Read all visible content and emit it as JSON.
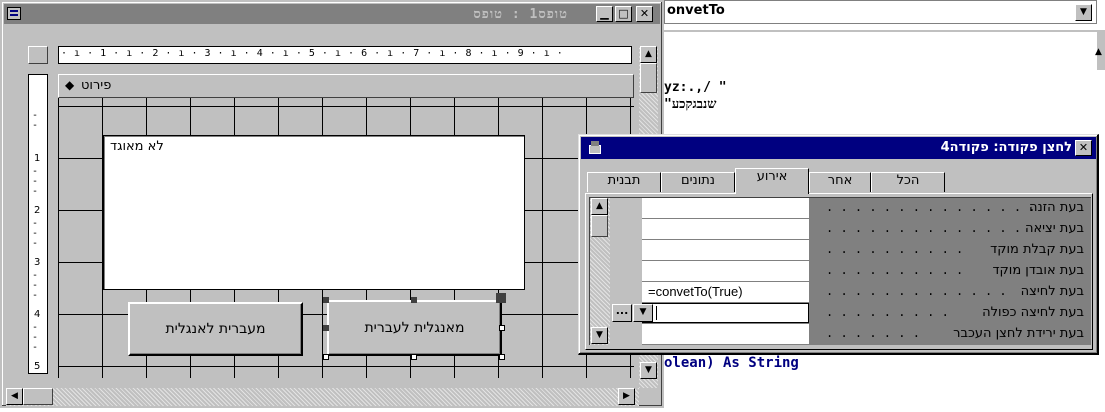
{
  "form_window": {
    "title": "טופס1 : טופס",
    "section_label": "פירוט",
    "ruler_h": [
      "1",
      "2",
      "3",
      "4",
      "5",
      "6",
      "7",
      "8",
      "9"
    ],
    "ruler_v": [
      "1",
      "2",
      "3",
      "4",
      "5"
    ],
    "textbox_text": "לא מאוגד",
    "button_left_label": "מעברית לאנגלית",
    "button_right_label": "מאנגלית לעברית"
  },
  "code_window": {
    "combo_text": "onvetTo",
    "code_lines": [
      "yz:.,/ \"",
      "\"שנבגקכע",
      "olean) As String"
    ]
  },
  "props_window": {
    "title": "לחצן פקודה: פקודה4",
    "tabs": [
      "הכל",
      "אחר",
      "אירוע",
      "נתונים",
      "תבנית"
    ],
    "active_tab": "אירוע",
    "rows": [
      {
        "label": "בעת הזנה",
        "value": ""
      },
      {
        "label": "בעת יציאה",
        "value": ""
      },
      {
        "label": "בעת קבלת מוקד",
        "value": ""
      },
      {
        "label": "בעת אובדן מוקד",
        "value": ""
      },
      {
        "label": "בעת לחיצה",
        "value": "=convetTo(True)"
      },
      {
        "label": "בעת לחיצה כפולה",
        "value": ""
      },
      {
        "label": "בעת ירידת לחצן העכבר",
        "value": ""
      }
    ],
    "builder_label": "..."
  },
  "colors": {
    "title_active": "#000080",
    "title_inactive": "#808080",
    "face": "#c0c0c0"
  }
}
